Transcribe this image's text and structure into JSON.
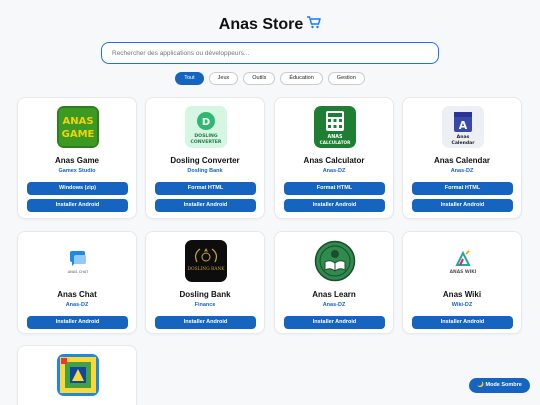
{
  "header": {
    "title": "Anas Store",
    "cart_icon": "cart-icon"
  },
  "search": {
    "placeholder": "Rechercher des applications ou développeurs..."
  },
  "tabs": [
    {
      "label": "Tout",
      "active": true
    },
    {
      "label": "Jeux",
      "active": false
    },
    {
      "label": "Outils",
      "active": false
    },
    {
      "label": "Éducation",
      "active": false
    },
    {
      "label": "Gestion",
      "active": false
    }
  ],
  "apps": [
    {
      "name": "Anas Game",
      "developer": "Gamex Studio",
      "icon_text": "ANAS GAME",
      "buttons": [
        "Windows (zip)",
        "Installer Android"
      ]
    },
    {
      "name": "Dosling Converter",
      "developer": "Dosling Bank",
      "icon_text": "DOSLING CONVERTER",
      "buttons": [
        "Format HTML",
        "Installer Android"
      ]
    },
    {
      "name": "Anas Calculator",
      "developer": "Anas-DZ",
      "icon_text": "ANAS CALCULATOR",
      "buttons": [
        "Format HTML",
        "Installer Android"
      ]
    },
    {
      "name": "Anas Calendar",
      "developer": "Anas-DZ",
      "icon_text": "Anas Calendar",
      "buttons": [
        "Format HTML",
        "Installer Android"
      ]
    },
    {
      "name": "Anas Chat",
      "developer": "Anas-DZ",
      "icon_text": "ANAS CHAT",
      "buttons": [
        "Installer Android"
      ]
    },
    {
      "name": "Dosling Bank",
      "developer": "Finance",
      "icon_text": "DOSLING BANK",
      "buttons": [
        "Installer Android"
      ]
    },
    {
      "name": "Anas Learn",
      "developer": "Anas-DZ",
      "icon_text": "",
      "buttons": [
        "Installer Android"
      ]
    },
    {
      "name": "Anas Wiki",
      "developer": "Wiki-DZ",
      "icon_text": "ANAS WIKI",
      "buttons": [
        "Installer Android"
      ]
    }
  ],
  "mode_button": "🌙 Mode Sombre",
  "colors": {
    "accent": "#1565c0",
    "background": "#f6f8fa"
  }
}
